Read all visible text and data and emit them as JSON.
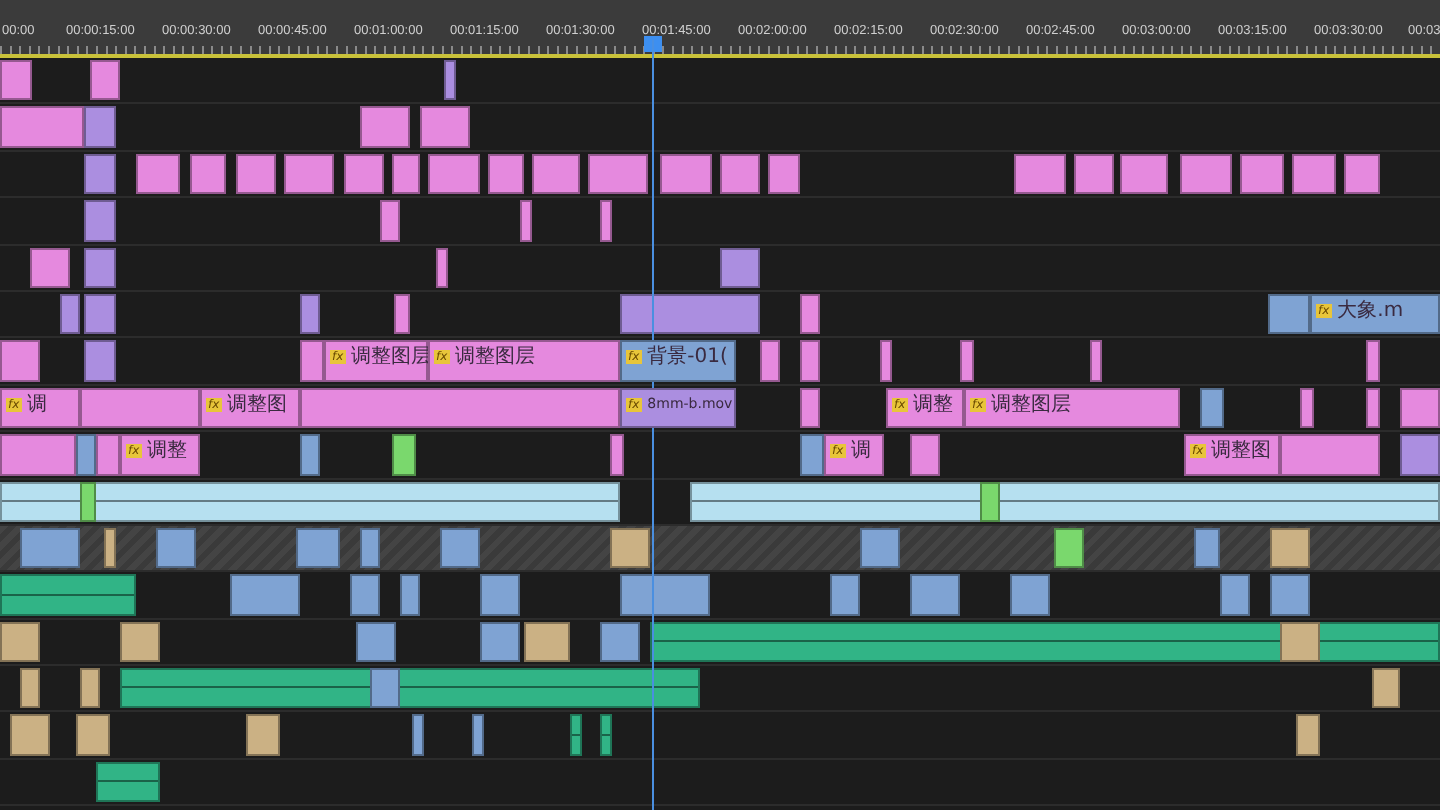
{
  "ruler": {
    "timecodes": [
      "00:00",
      "00:00:15:00",
      "00:00:30:00",
      "00:00:45:00",
      "00:01:00:00",
      "00:01:15:00",
      "00:01:30:00",
      "00:01:45:00",
      "00:02:00:00",
      "00:02:15:00",
      "00:02:30:00",
      "00:02:45:00",
      "00:03:00:00",
      "00:03:15:00",
      "00:03:30:00",
      "00:03"
    ]
  },
  "labeled_clips": [
    {
      "label": "大象.m",
      "badge": "fx",
      "color": "#7fa3d3"
    },
    {
      "label": "调整图层",
      "badge": "fx",
      "color": "#e589de"
    },
    {
      "label": "调整图层",
      "badge": "fx",
      "color": "#e589de"
    },
    {
      "label": "背景-01(",
      "badge": "fx",
      "color": "#7fa3d3"
    },
    {
      "label": "调",
      "badge": "fx",
      "color": "#e589de"
    },
    {
      "label": "调整图",
      "badge": "fx",
      "color": "#e589de"
    },
    {
      "label": "8mm-b.mov",
      "badge": "fx",
      "color": "#ab8ee0"
    },
    {
      "label": "调整",
      "badge": "fx",
      "color": "#e589de"
    },
    {
      "label": "调整图层",
      "badge": "fx",
      "color": "#e589de"
    },
    {
      "label": "调整",
      "badge": "fx",
      "color": "#e589de"
    },
    {
      "label": "调",
      "badge": "fx",
      "color": "#e589de"
    },
    {
      "label": "调整图",
      "badge": "fx",
      "color": "#e589de"
    }
  ]
}
